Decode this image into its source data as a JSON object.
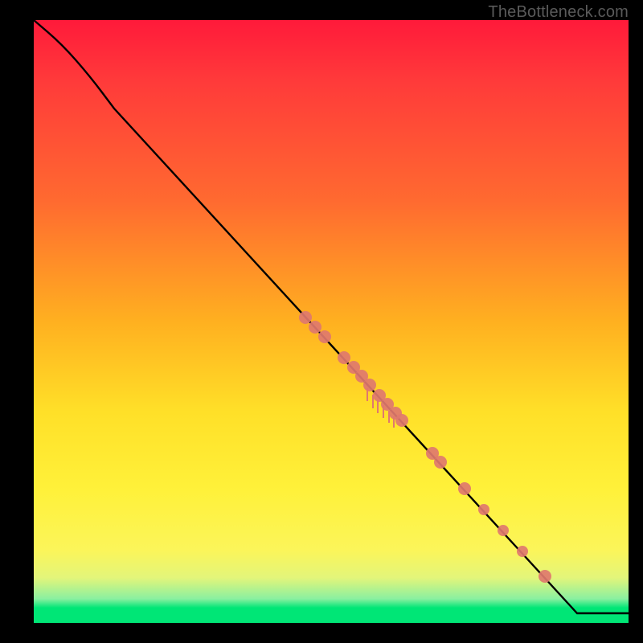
{
  "watermark": "TheBottleneck.com",
  "chart_data": {
    "type": "line",
    "title": "",
    "xlabel": "",
    "ylabel": "",
    "xlim": [
      0,
      740
    ],
    "ylim": [
      0,
      750
    ],
    "series": [
      {
        "name": "curve",
        "points": [
          {
            "x": 0,
            "y": 0
          },
          {
            "x": 35,
            "y": 30
          },
          {
            "x": 70,
            "y": 70
          },
          {
            "x": 100,
            "y": 110
          },
          {
            "x": 676,
            "y": 738
          },
          {
            "x": 740,
            "y": 738
          }
        ]
      }
    ],
    "markers": [
      {
        "x": 338,
        "y": 370,
        "r": 8
      },
      {
        "x": 350,
        "y": 382,
        "r": 8
      },
      {
        "x": 362,
        "y": 394,
        "r": 8
      },
      {
        "x": 386,
        "y": 420,
        "r": 8
      },
      {
        "x": 398,
        "y": 432,
        "r": 8
      },
      {
        "x": 408,
        "y": 443,
        "r": 8
      },
      {
        "x": 418,
        "y": 454,
        "r": 8
      },
      {
        "x": 430,
        "y": 467,
        "r": 8
      },
      {
        "x": 440,
        "y": 478,
        "r": 8
      },
      {
        "x": 450,
        "y": 489,
        "r": 8
      },
      {
        "x": 458,
        "y": 498,
        "r": 8
      },
      {
        "x": 496,
        "y": 539,
        "r": 8
      },
      {
        "x": 506,
        "y": 550,
        "r": 8
      },
      {
        "x": 536,
        "y": 583,
        "r": 8
      },
      {
        "x": 560,
        "y": 609,
        "r": 7
      },
      {
        "x": 584,
        "y": 635,
        "r": 7
      },
      {
        "x": 608,
        "y": 661,
        "r": 7
      },
      {
        "x": 636,
        "y": 692,
        "r": 8
      }
    ],
    "ticks": [
      {
        "x": 415,
        "y": 458,
        "len": 16
      },
      {
        "x": 422,
        "y": 466,
        "len": 17
      },
      {
        "x": 428,
        "y": 472,
        "len": 17
      },
      {
        "x": 435,
        "y": 479,
        "len": 16
      },
      {
        "x": 442,
        "y": 486,
        "len": 15
      },
      {
        "x": 448,
        "y": 493,
        "len": 14
      }
    ],
    "colors": {
      "curve": "#000000",
      "marker": "#e0786e",
      "gradient_top": "#ff1a3a",
      "gradient_mid": "#ffe028",
      "gradient_bottom": "#00e676"
    }
  }
}
